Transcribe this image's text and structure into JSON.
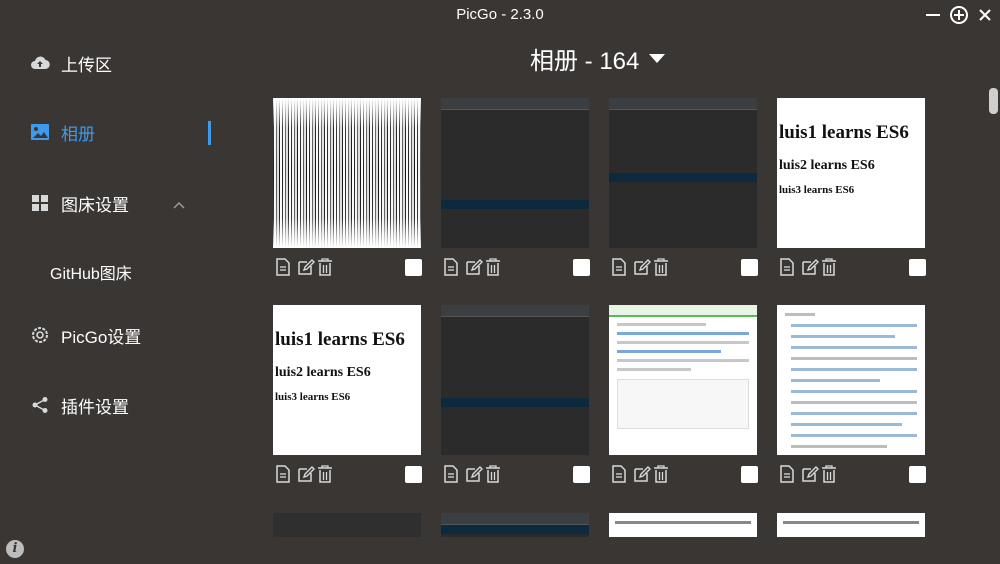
{
  "window": {
    "title": "PicGo - 2.3.0"
  },
  "sidebar": {
    "items": [
      {
        "label": "上传区",
        "icon": "cloud-upload-icon"
      },
      {
        "label": "相册",
        "icon": "image-icon",
        "active": true
      },
      {
        "label": "图床设置",
        "icon": "grid-icon"
      },
      {
        "label": "PicGo设置",
        "icon": "gear-icon"
      },
      {
        "label": "插件设置",
        "icon": "share-icon"
      }
    ],
    "sub_items": [
      {
        "label": "GitHub图床"
      }
    ]
  },
  "album": {
    "title": "相册 - 164"
  },
  "thumbnails": {
    "es6": {
      "line1": "luis1 learns ES6",
      "line2": "luis2 learns ES6",
      "line3": "luis3 learns ES6"
    }
  },
  "colors": {
    "background": "#3a3634",
    "accent": "#3d9aed",
    "text": "#ffffff"
  }
}
